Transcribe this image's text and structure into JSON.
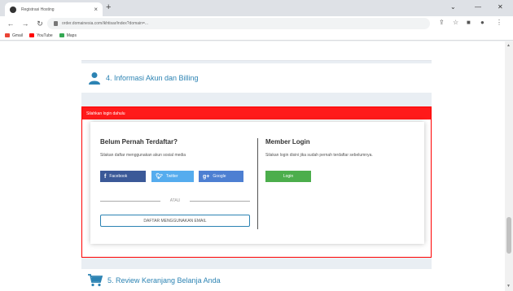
{
  "browser": {
    "tab_title": "Registrasi Hosting",
    "tab_close": "×",
    "new_tab": "+",
    "url": "order.domainesia.com/ikhtisar/index?domain=...",
    "bookmarks": [
      {
        "label": "Gmail",
        "color": "#ea4335"
      },
      {
        "label": "YouTube",
        "color": "#ff0000"
      },
      {
        "label": "Maps",
        "color": "#34a853"
      }
    ]
  },
  "sections": {
    "account": {
      "title": "4. Informasi Akun dan Billing"
    },
    "review": {
      "title": "5. Review Keranjang Belanja Anda"
    }
  },
  "alert": {
    "text": "Silahkan login dahulu"
  },
  "register": {
    "heading": "Belum Pernah Terdaftar?",
    "subtext": "Silakan daftar menggunakan akun sosial media",
    "facebook": "Facebook",
    "twitter": "Twitter",
    "google": "Google",
    "or": "ATAU",
    "email_button": "DAFTAR MENGGUNAKAN EMAIL"
  },
  "login": {
    "heading": "Member Login",
    "subtext": "Silakan login disini jika sudah pernah terdaftar sebelumnya.",
    "button": "Login"
  },
  "colors": {
    "alert": "#ff1a1a",
    "facebook": "#3b5998",
    "twitter": "#55acee",
    "google": "#4d7fd2",
    "login": "#4cae4c",
    "accent": "#2c83b3"
  }
}
